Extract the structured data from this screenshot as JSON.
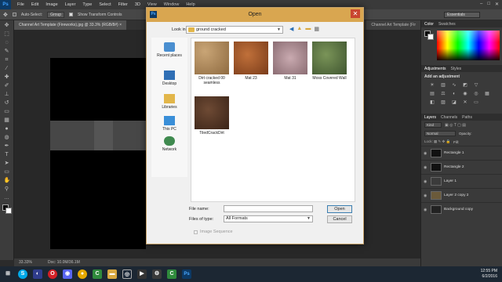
{
  "photoshop": {
    "logo": "Ps",
    "menu": [
      "File",
      "Edit",
      "Image",
      "Layer",
      "Type",
      "Select",
      "Filter",
      "3D",
      "View",
      "Window",
      "Help"
    ],
    "options": {
      "auto_select_label": "Auto-Select:",
      "auto_select_value": "Group",
      "transform_label": "Show Transform Controls"
    },
    "workspace": "Essentials",
    "doc_tab": "Channel Art Template (Fireworks).jpg @ 33.3% (RGB/8#) ×",
    "doc_tab_right": "Channel Art Template (Fir",
    "status": {
      "zoom": "33.33%",
      "doc": "Doc: 10.0M/36.1M"
    },
    "panels": {
      "color_tabs": [
        "Color",
        "Swatches"
      ],
      "adj_tabs": [
        "Adjustments",
        "Styles"
      ],
      "adj_title": "Add an adjustment",
      "layers_tabs": [
        "Layers",
        "Channels",
        "Paths"
      ],
      "kind": "Kind",
      "blend": "Normal",
      "opacity_label": "Opacity:",
      "fill_label": "Fill:",
      "layers": [
        {
          "name": "Rectangle 1",
          "thumb": "#111111"
        },
        {
          "name": "Rectangle 2",
          "thumb": "#111111"
        },
        {
          "name": "Layer 1",
          "thumb": "#3b3b3b"
        },
        {
          "name": "Layer 2 copy 2",
          "thumb": "#6b5a3a"
        },
        {
          "name": "Background copy",
          "thumb": "#222222"
        }
      ]
    }
  },
  "dialog": {
    "title": "Open",
    "look_in_label": "Look in:",
    "look_in_value": "ground cracked",
    "places": [
      "Recent places",
      "Desktop",
      "Libraries",
      "This PC",
      "Network"
    ],
    "files": [
      {
        "name": "Dirt cracked 00 seamless",
        "color": "#b08a5a"
      },
      {
        "name": "Mat 23",
        "color": "#a45a2c"
      },
      {
        "name": "Mat 31",
        "color": "#b89aa0"
      },
      {
        "name": "Moss Covered Wall",
        "color": "#5f7a45"
      },
      {
        "name": "TiledCrackDirt",
        "color": "#5a3a28"
      }
    ],
    "file_name_label": "File name:",
    "file_name_value": "",
    "files_of_type_label": "Files of type:",
    "files_of_type_value": "All Formats",
    "open_button": "Open",
    "cancel_button": "Cancel",
    "image_sequence": "Image Sequence"
  },
  "taskbar": {
    "time": "12:55 PM",
    "date": "6/2/2016"
  }
}
